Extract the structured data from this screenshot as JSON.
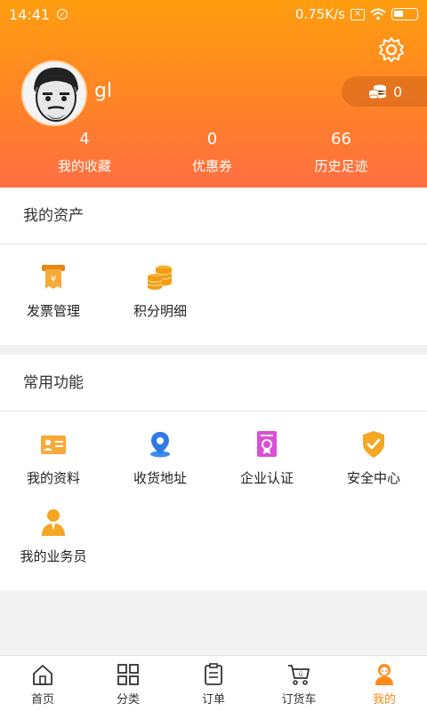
{
  "status_bar": {
    "time": "14:41",
    "speed": "0.75K/s"
  },
  "profile": {
    "username": "gl",
    "points": "0"
  },
  "stats": [
    {
      "value": "4",
      "label": "我的收藏"
    },
    {
      "value": "0",
      "label": "优惠券"
    },
    {
      "value": "66",
      "label": "历史足迹"
    }
  ],
  "assets": {
    "title": "我的资产",
    "items": [
      {
        "label": "发票管理",
        "icon": "invoice-icon"
      },
      {
        "label": "积分明细",
        "icon": "coins-icon"
      }
    ]
  },
  "common": {
    "title": "常用功能",
    "items": [
      {
        "label": "我的资料",
        "icon": "profile-card-icon"
      },
      {
        "label": "收货地址",
        "icon": "location-pin-icon"
      },
      {
        "label": "企业认证",
        "icon": "certificate-icon"
      },
      {
        "label": "安全中心",
        "icon": "shield-icon"
      },
      {
        "label": "我的业务员",
        "icon": "salesperson-icon"
      }
    ]
  },
  "tabbar": [
    {
      "label": "首页",
      "icon": "home-icon"
    },
    {
      "label": "分类",
      "icon": "category-icon"
    },
    {
      "label": "订单",
      "icon": "order-icon"
    },
    {
      "label": "订货车",
      "icon": "cart-icon"
    },
    {
      "label": "我的",
      "icon": "user-icon",
      "active": true
    }
  ],
  "colors": {
    "accent": "#ff8a17",
    "header_top": "#ff9d0f",
    "header_bottom": "#ff6e42"
  }
}
